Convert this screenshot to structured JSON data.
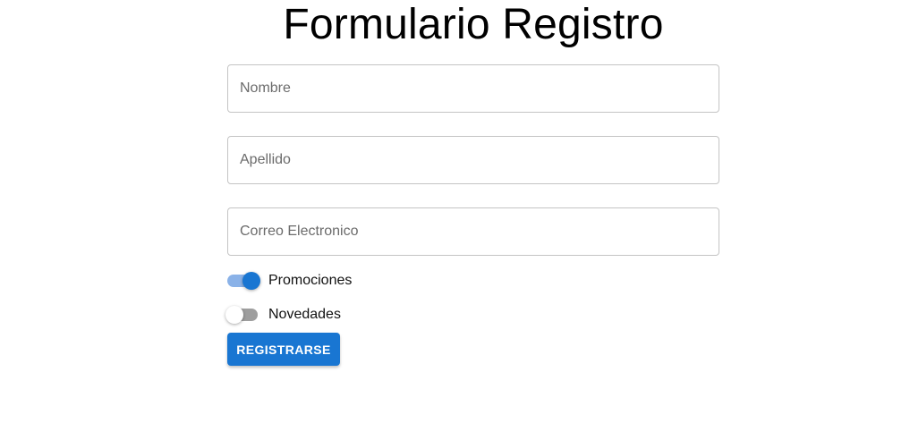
{
  "form": {
    "title": "Formulario Registro",
    "fields": [
      {
        "placeholder": "Nombre",
        "value": ""
      },
      {
        "placeholder": "Apellido",
        "value": ""
      },
      {
        "placeholder": "Correo Electronico",
        "value": ""
      }
    ],
    "toggles": [
      {
        "label": "Promociones",
        "checked": true
      },
      {
        "label": "Novedades",
        "checked": false
      }
    ],
    "submit_label": "REGISTRARSE"
  },
  "colors": {
    "accent": "#1976d2",
    "switch_track_on": "#8ab2e8",
    "switch_track_off": "#9e9e9e",
    "field_border": "#c4c4c4"
  }
}
